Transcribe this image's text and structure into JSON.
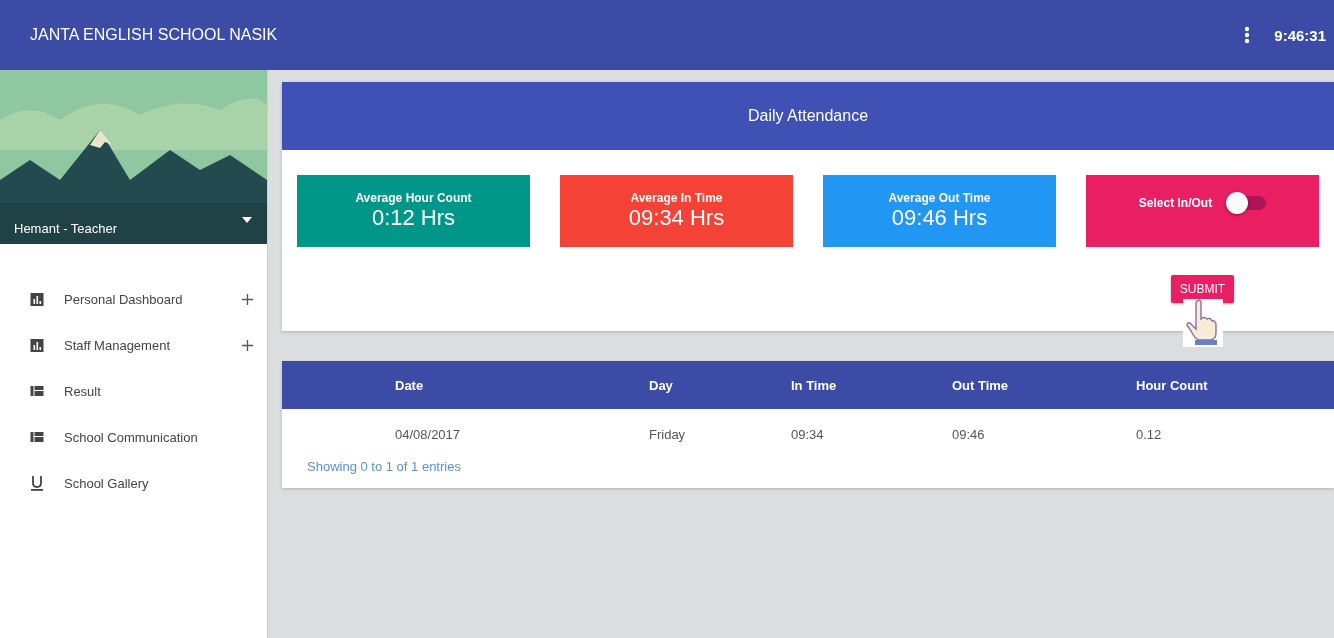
{
  "header": {
    "title": "JANTA ENGLISH SCHOOL NASIK",
    "clock": "9:46:31"
  },
  "profile": {
    "name": "Hemant - Teacher"
  },
  "sidebar": {
    "items": [
      {
        "label": "Personal Dashboard",
        "kind": "chart",
        "expandable": true
      },
      {
        "label": "Staff Management",
        "kind": "chart",
        "expandable": true
      },
      {
        "label": "Result",
        "kind": "list",
        "expandable": false
      },
      {
        "label": "School Communication",
        "kind": "list",
        "expandable": false
      },
      {
        "label": "School Gallery",
        "kind": "underline",
        "expandable": false
      }
    ]
  },
  "attendance": {
    "title": "Daily Attendance",
    "stats": [
      {
        "kind": "stat",
        "label": "Average Hour Count",
        "value": "0:12 Hrs",
        "color": "#009688"
      },
      {
        "kind": "stat",
        "label": "Average In Time",
        "value": "09:34 Hrs",
        "color": "#f44336"
      },
      {
        "kind": "stat",
        "label": "Average Out Time",
        "value": "09:46 Hrs",
        "color": "#2196f3"
      },
      {
        "kind": "toggle",
        "label": "Select In/Out",
        "on": false,
        "color": "#e91e63"
      }
    ],
    "submit": "SUBMIT"
  },
  "table": {
    "columns": [
      "Date",
      "Day",
      "In Time",
      "Out Time",
      "Hour Count"
    ],
    "rows": [
      [
        "04/08/2017",
        "Friday",
        "09:34",
        "09:46",
        "0.12"
      ]
    ],
    "info": "Showing 0 to 1 of 1 entries"
  }
}
